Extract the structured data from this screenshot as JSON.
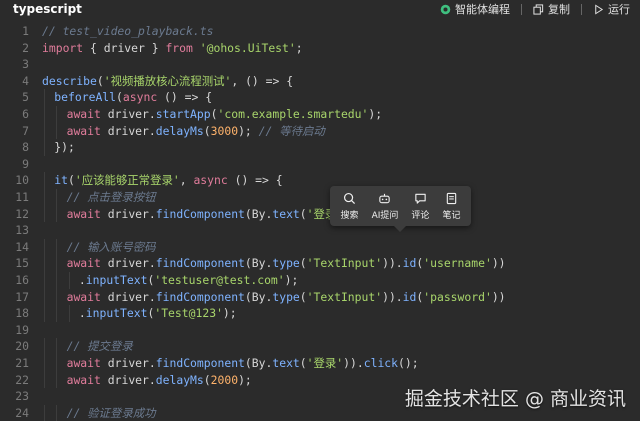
{
  "header": {
    "language": "typescript",
    "actions": [
      {
        "label": "智能体编程",
        "icon": "agent-icon",
        "accent": "#3fbf7f"
      },
      {
        "label": "复制",
        "icon": "copy-icon"
      },
      {
        "label": "运行",
        "icon": "play-icon"
      }
    ]
  },
  "code": {
    "lines": [
      {
        "n": "1",
        "indent": 0,
        "tokens": [
          [
            "c",
            "// test_video_playback.ts"
          ]
        ]
      },
      {
        "n": "2",
        "indent": 0,
        "tokens": [
          [
            "k",
            "import"
          ],
          [
            "p",
            " { driver } "
          ],
          [
            "k",
            "from"
          ],
          [
            "p",
            " "
          ],
          [
            "s",
            "'@ohos.UiTest'"
          ],
          [
            "p",
            ";"
          ]
        ]
      },
      {
        "n": "3",
        "indent": 0,
        "tokens": []
      },
      {
        "n": "4",
        "indent": 0,
        "tokens": [
          [
            "f",
            "describe"
          ],
          [
            "p",
            "("
          ],
          [
            "s",
            "'视频播放核心流程测试'"
          ],
          [
            "p",
            ", () => {"
          ]
        ]
      },
      {
        "n": "5",
        "indent": 1,
        "tokens": [
          [
            "f",
            "beforeAll"
          ],
          [
            "p",
            "("
          ],
          [
            "k",
            "async"
          ],
          [
            "p",
            " () => {"
          ]
        ]
      },
      {
        "n": "6",
        "indent": 2,
        "tokens": [
          [
            "k",
            "await"
          ],
          [
            "p",
            " driver."
          ],
          [
            "f",
            "startApp"
          ],
          [
            "p",
            "("
          ],
          [
            "s",
            "'com.example.smartedu'"
          ],
          [
            "p",
            ");"
          ]
        ]
      },
      {
        "n": "7",
        "indent": 2,
        "tokens": [
          [
            "k",
            "await"
          ],
          [
            "p",
            " driver."
          ],
          [
            "f",
            "delayMs"
          ],
          [
            "p",
            "("
          ],
          [
            "n",
            "3000"
          ],
          [
            "p",
            "); "
          ],
          [
            "c",
            "// 等待启动"
          ]
        ]
      },
      {
        "n": "8",
        "indent": 1,
        "tokens": [
          [
            "p",
            "});"
          ]
        ]
      },
      {
        "n": "9",
        "indent": 0,
        "tokens": []
      },
      {
        "n": "10",
        "indent": 1,
        "tokens": [
          [
            "f",
            "it"
          ],
          [
            "p",
            "("
          ],
          [
            "s",
            "'应该能够正常登录'"
          ],
          [
            "p",
            ", "
          ],
          [
            "k",
            "async"
          ],
          [
            "p",
            " () => {"
          ]
        ]
      },
      {
        "n": "11",
        "indent": 2,
        "tokens": [
          [
            "c",
            "// 点击登录按钮"
          ]
        ]
      },
      {
        "n": "12",
        "indent": 2,
        "tokens": [
          [
            "k",
            "await"
          ],
          [
            "p",
            " driver."
          ],
          [
            "f",
            "findComponent"
          ],
          [
            "p",
            "(By."
          ],
          [
            "f",
            "text"
          ],
          [
            "p",
            "("
          ],
          [
            "s",
            "'登录'"
          ],
          [
            "p",
            ")"
          ]
        ]
      },
      {
        "n": "13",
        "indent": 0,
        "tokens": []
      },
      {
        "n": "14",
        "indent": 2,
        "tokens": [
          [
            "c",
            "// 输入账号密码"
          ]
        ]
      },
      {
        "n": "15",
        "indent": 2,
        "tokens": [
          [
            "k",
            "await"
          ],
          [
            "p",
            " driver."
          ],
          [
            "f",
            "findComponent"
          ],
          [
            "p",
            "(By."
          ],
          [
            "f",
            "type"
          ],
          [
            "p",
            "("
          ],
          [
            "s",
            "'TextInput'"
          ],
          [
            "p",
            "))."
          ],
          [
            "f",
            "id"
          ],
          [
            "p",
            "("
          ],
          [
            "s",
            "'username'"
          ],
          [
            "p",
            "))"
          ]
        ]
      },
      {
        "n": "16",
        "indent": 3,
        "tokens": [
          [
            "p",
            "."
          ],
          [
            "f",
            "inputText"
          ],
          [
            "p",
            "("
          ],
          [
            "s",
            "'testuser@test.com'"
          ],
          [
            "p",
            ");"
          ]
        ]
      },
      {
        "n": "17",
        "indent": 2,
        "tokens": [
          [
            "k",
            "await"
          ],
          [
            "p",
            " driver."
          ],
          [
            "f",
            "findComponent"
          ],
          [
            "p",
            "(By."
          ],
          [
            "f",
            "type"
          ],
          [
            "p",
            "("
          ],
          [
            "s",
            "'TextInput'"
          ],
          [
            "p",
            "))."
          ],
          [
            "f",
            "id"
          ],
          [
            "p",
            "("
          ],
          [
            "s",
            "'password'"
          ],
          [
            "p",
            "))"
          ]
        ]
      },
      {
        "n": "18",
        "indent": 3,
        "tokens": [
          [
            "p",
            "."
          ],
          [
            "f",
            "inputText"
          ],
          [
            "p",
            "("
          ],
          [
            "s",
            "'Test@123'"
          ],
          [
            "p",
            ");"
          ]
        ]
      },
      {
        "n": "19",
        "indent": 0,
        "tokens": []
      },
      {
        "n": "20",
        "indent": 2,
        "tokens": [
          [
            "c",
            "// 提交登录"
          ]
        ]
      },
      {
        "n": "21",
        "indent": 2,
        "tokens": [
          [
            "k",
            "await"
          ],
          [
            "p",
            " driver."
          ],
          [
            "f",
            "findComponent"
          ],
          [
            "p",
            "(By."
          ],
          [
            "f",
            "text"
          ],
          [
            "p",
            "("
          ],
          [
            "s",
            "'登录'"
          ],
          [
            "p",
            "))."
          ],
          [
            "f",
            "click"
          ],
          [
            "p",
            "();"
          ]
        ]
      },
      {
        "n": "22",
        "indent": 2,
        "tokens": [
          [
            "k",
            "await"
          ],
          [
            "p",
            " driver."
          ],
          [
            "f",
            "delayMs"
          ],
          [
            "p",
            "("
          ],
          [
            "n",
            "2000"
          ],
          [
            "p",
            ");"
          ]
        ]
      },
      {
        "n": "23",
        "indent": 0,
        "tokens": []
      },
      {
        "n": "24",
        "indent": 2,
        "tokens": [
          [
            "c",
            "// 验证登录成功"
          ]
        ]
      }
    ]
  },
  "popup": {
    "items": [
      {
        "label": "搜索",
        "icon": "search-icon"
      },
      {
        "label": "AI提问",
        "icon": "ai-robot-icon"
      },
      {
        "label": "评论",
        "icon": "comment-icon"
      },
      {
        "label": "笔记",
        "icon": "note-icon"
      }
    ]
  },
  "watermark": "掘金技术社区 @ 商业资讯"
}
